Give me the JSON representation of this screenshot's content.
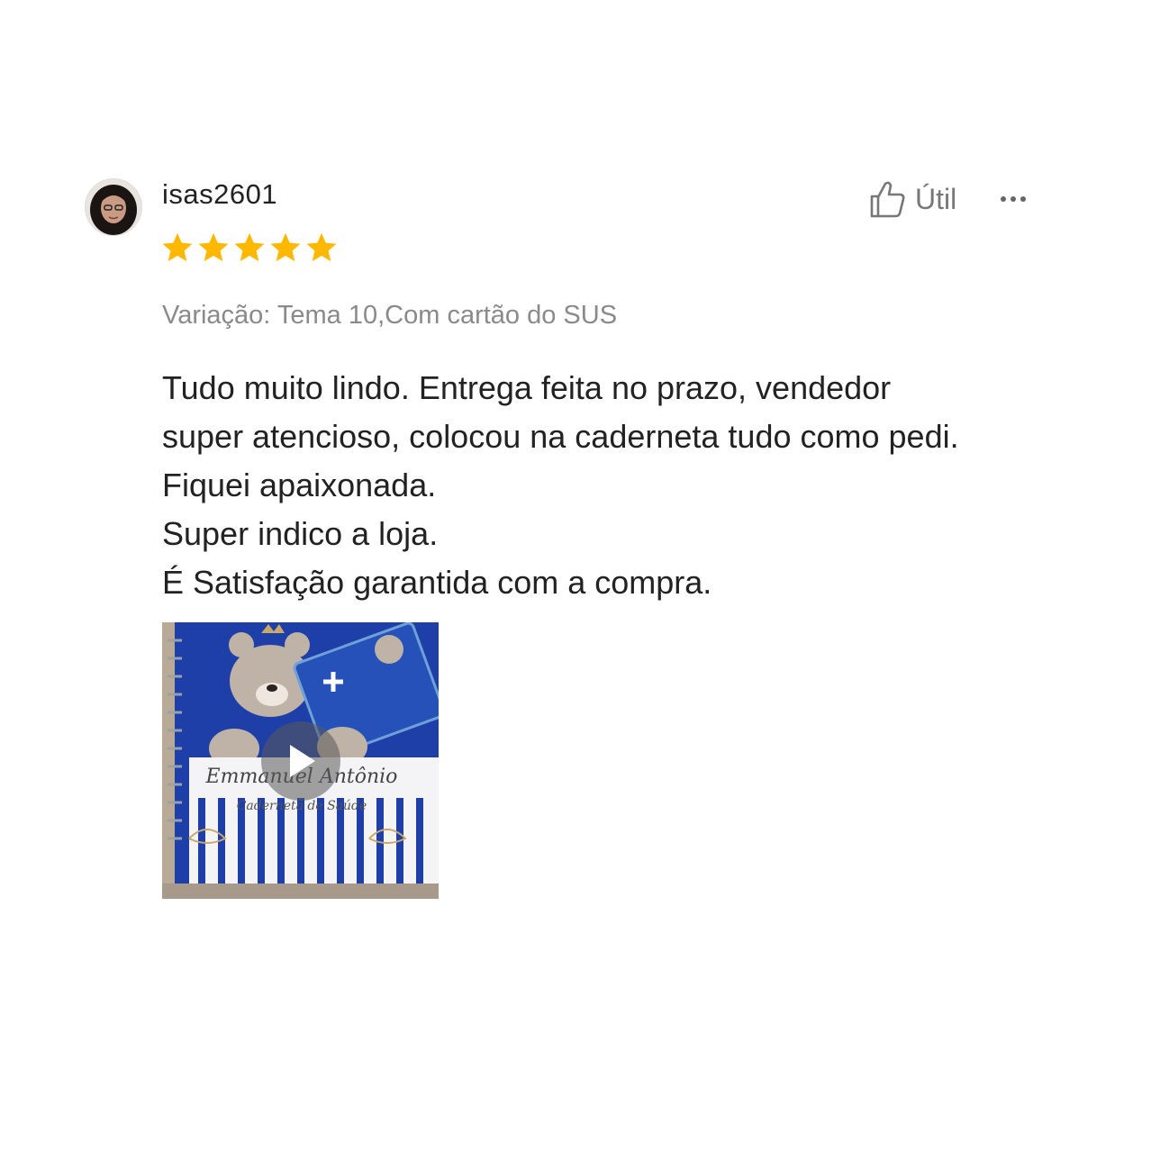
{
  "review": {
    "username": "isas2601",
    "rating": 5,
    "rating_max": 5,
    "star_color": "#FFB800",
    "helpful": {
      "label": "Útil",
      "icon": "thumbs-up-icon"
    },
    "more_icon": "more-horizontal-icon",
    "variation": "Variação: Tema 10,Com cartão do SUS",
    "comment_lines": [
      "Tudo muito lindo. Entrega feita no prazo, vendedor",
      "super atencioso, colocou na caderneta tudo como pedi.",
      "Fiquei apaixonada.",
      "Super indico a loja.",
      "É Satisfação garantida com a compra."
    ],
    "media": {
      "type": "video",
      "caption_name": "Emmanuel Antônio",
      "caption_sub": "Caderneta de Saúde",
      "icon": "play-icon"
    }
  }
}
